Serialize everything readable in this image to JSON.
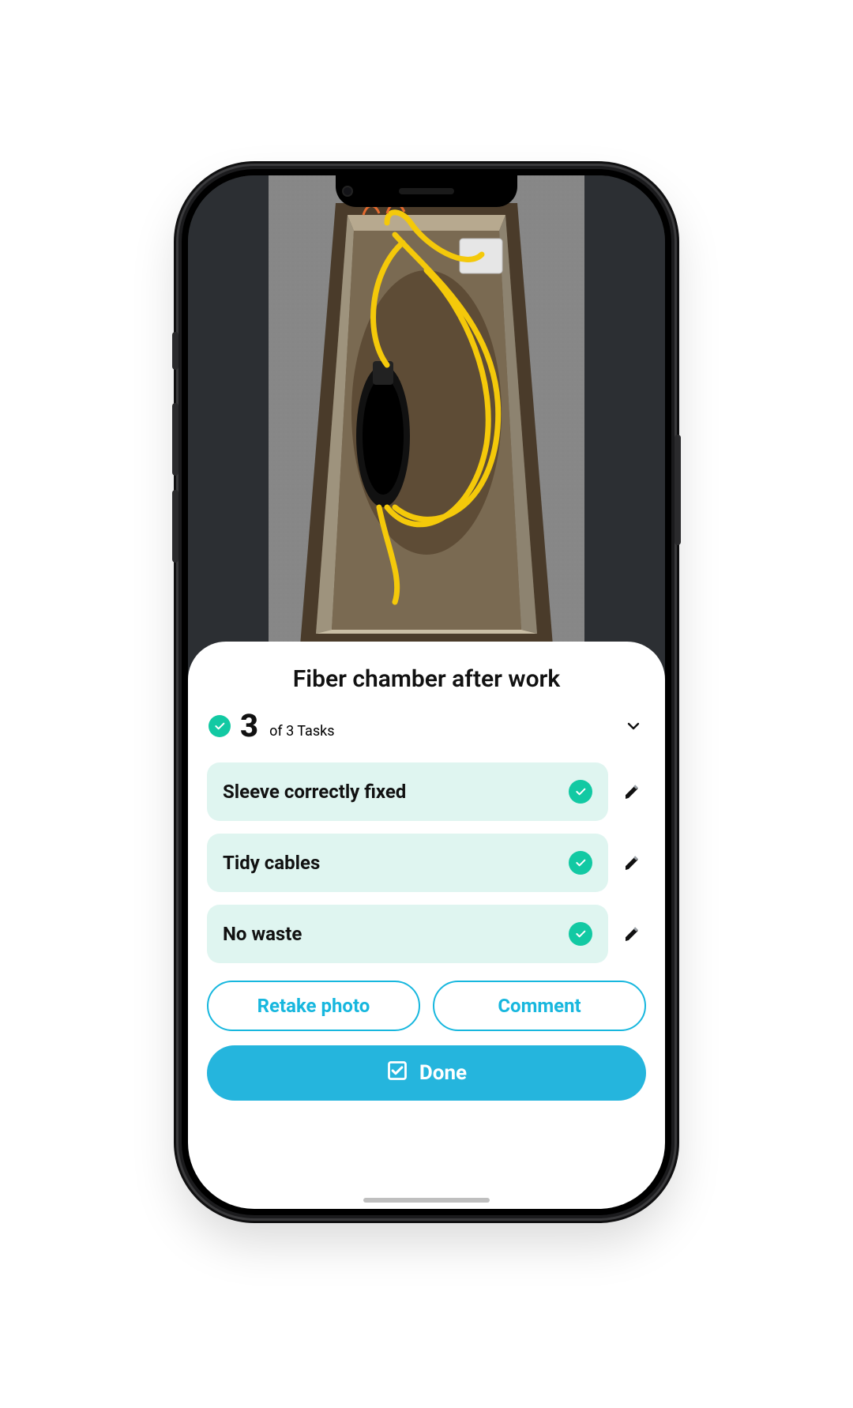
{
  "title": "Fiber chamber after work",
  "summary": {
    "done_count": "3",
    "suffix": "of 3 Tasks"
  },
  "tasks": [
    {
      "label": "Sleeve correctly fixed",
      "checked": true
    },
    {
      "label": "Tidy cables",
      "checked": true
    },
    {
      "label": "No waste",
      "checked": true
    }
  ],
  "buttons": {
    "retake": "Retake photo",
    "comment": "Comment",
    "done": "Done"
  },
  "colors": {
    "accent_green": "#12c9a3",
    "accent_blue": "#25b5dd",
    "task_bg": "#dff5f0"
  }
}
